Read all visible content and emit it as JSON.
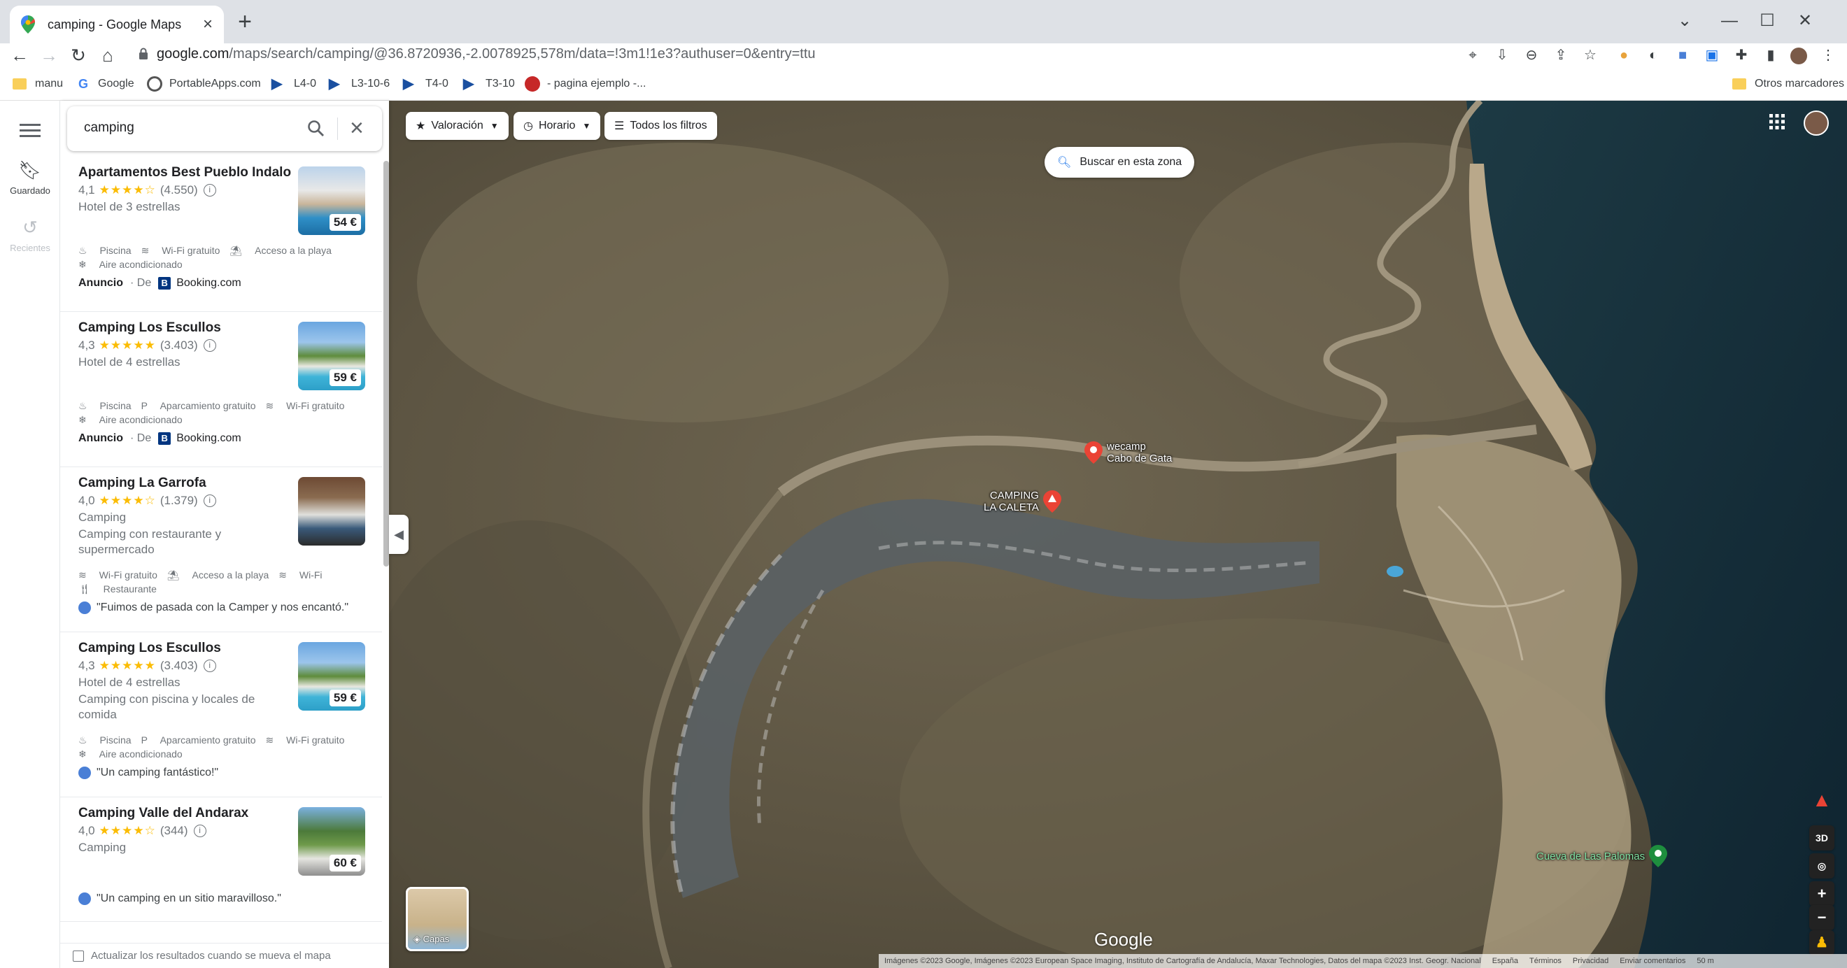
{
  "browser": {
    "tab_title": "camping - Google Maps",
    "url_domain": "google.com",
    "url_path": "/maps/search/camping/@36.8720936,-2.0078925,578m/data=!3m1!1e3?authuser=0&entry=ttu",
    "bookmarks": [
      {
        "label": "manu",
        "icon": "folder-icon"
      },
      {
        "label": "Google",
        "icon": "google-icon"
      },
      {
        "label": "PortableApps.com",
        "icon": "portableapps-icon"
      },
      {
        "label": "L4-0",
        "icon": "bookmark-blue-icon"
      },
      {
        "label": "L3-10-6",
        "icon": "bookmark-blue-icon"
      },
      {
        "label": "T4-0",
        "icon": "bookmark-blue-icon"
      },
      {
        "label": "T3-10",
        "icon": "bookmark-blue-icon"
      },
      {
        "label": "- pagina ejemplo -...",
        "icon": "ladybug-icon"
      }
    ],
    "other_bookmarks": "Otros marcadores"
  },
  "rail": {
    "saved": "Guardado",
    "recent": "Recientes"
  },
  "search": {
    "query": "camping"
  },
  "results": [
    {
      "name": "Apartamentos Best Pueblo Indalo",
      "rating": "4,1",
      "stars": "★★★★☆",
      "reviews": "(4.550)",
      "category": "Hotel de 3 estrellas",
      "price": "54 €",
      "amenities_row1": [
        "Piscina",
        "Wi-Fi gratuito",
        "Acceso a la playa"
      ],
      "amenities_row2": [
        "Aire acondicionado"
      ],
      "ad_label": "Anuncio",
      "ad_from": "De",
      "ad_source": "Booking.com"
    },
    {
      "name": "Camping Los Escullos",
      "rating": "4,3",
      "stars": "★★★★★",
      "reviews": "(3.403)",
      "category": "Hotel de 4 estrellas",
      "price": "59 €",
      "amenities_row1": [
        "Piscina",
        "Aparcamiento gratuito",
        "Wi-Fi gratuito"
      ],
      "amenities_row2": [
        "Aire acondicionado"
      ],
      "ad_label": "Anuncio",
      "ad_from": "De",
      "ad_source": "Booking.com"
    },
    {
      "name": "Camping La Garrofa",
      "rating": "4,0",
      "stars": "★★★★☆",
      "reviews": "(1.379)",
      "category": "Camping",
      "desc1": "Camping con restaurante y",
      "desc2": "supermercado",
      "amenities_row1": [
        "Wi-Fi gratuito",
        "Acceso a la playa",
        "Wi-Fi"
      ],
      "amenities_row2": [
        "Restaurante"
      ],
      "review": "\"Fuimos de pasada con la Camper y nos encantó.\""
    },
    {
      "name": "Camping Los Escullos",
      "rating": "4,3",
      "stars": "★★★★★",
      "reviews": "(3.403)",
      "category": "Hotel de 4 estrellas",
      "desc1": "Camping con piscina y locales de",
      "desc2": "comida",
      "price": "59 €",
      "amenities_row1": [
        "Piscina",
        "Aparcamiento gratuito",
        "Wi-Fi gratuito"
      ],
      "amenities_row2": [
        "Aire acondicionado"
      ],
      "review": "\"Un camping fantástico!\""
    },
    {
      "name": "Camping Valle del Andarax",
      "rating": "4,0",
      "stars": "★★★★☆",
      "reviews": "(344)",
      "category": "Camping",
      "price": "60 €",
      "review": "\"Un camping en un sitio maravilloso.\""
    }
  ],
  "footer": {
    "update_label": "Actualizar los resultados cuando se mueva el mapa"
  },
  "map": {
    "chips": [
      "Valoración",
      "Horario",
      "Todos los filtros"
    ],
    "search_zone": "Buscar en esta zona",
    "places": {
      "wecamp": "wecamp\nCabo de Gata",
      "caleta": "CAMPING\nLA CALETA",
      "cueva": "Cueva de Las Palomas"
    },
    "layers_label": "Capas",
    "logo": "Google",
    "controls": {
      "three_d": "3D"
    },
    "attribution": "Imágenes ©2023 Google, Imágenes ©2023 European Space Imaging, Instituto de Cartografía de Andalucía, Maxar Technologies, Datos del mapa ©2023 Inst. Geogr. Nacional",
    "footer_links": [
      "España",
      "Términos",
      "Privacidad",
      "Enviar comentarios"
    ],
    "scale": "50 m"
  },
  "colors": {
    "accent": "#1a73e8",
    "star": "#fbbc04",
    "pin_red": "#ea4335",
    "booking": "#003580"
  }
}
